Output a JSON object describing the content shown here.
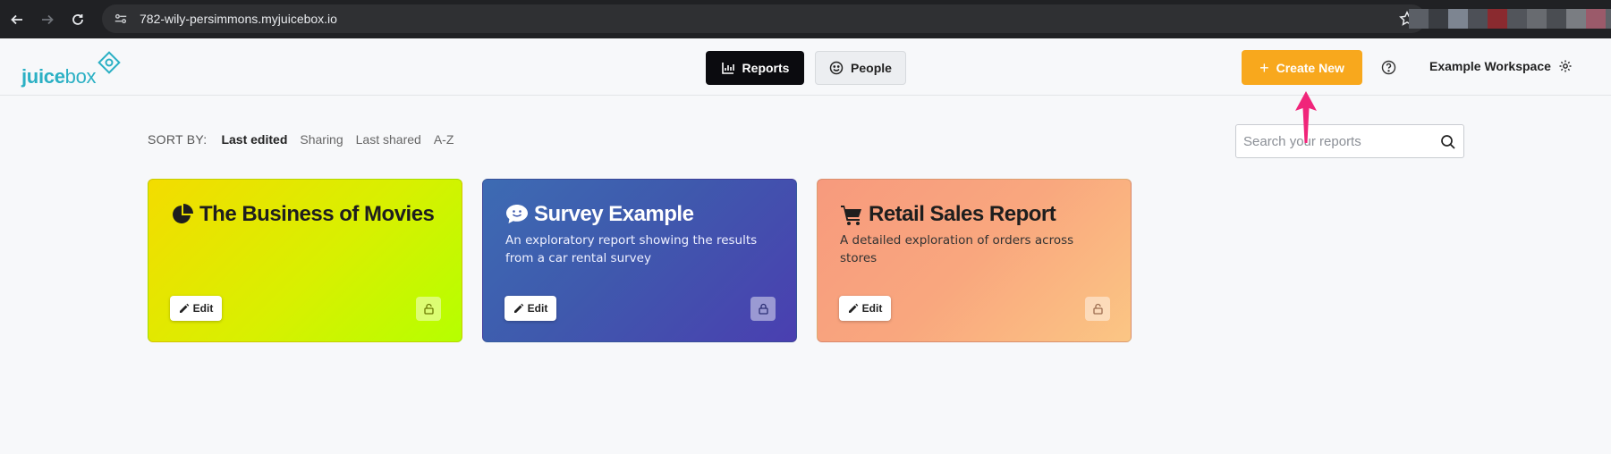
{
  "browser": {
    "url": "782-wily-persimmons.myjuicebox.io",
    "ext_colors": [
      "#5b5f66",
      "#3a3d42",
      "#7d8591",
      "#4d5057",
      "#8a2a2f",
      "#52555b",
      "#686b70",
      "#4a4d52",
      "#7a7d82",
      "#9b5a6a",
      "#5f6268"
    ]
  },
  "header": {
    "logo_text_bold": "juice",
    "logo_text_light": "box",
    "tabs": [
      {
        "label": "Reports",
        "icon": "bar-chart-icon",
        "active": true
      },
      {
        "label": "People",
        "icon": "smiley-icon",
        "active": false
      }
    ],
    "create_label": "Create New",
    "workspace_label": "Example Workspace"
  },
  "sort": {
    "label": "SORT BY:",
    "options": [
      {
        "label": "Last edited",
        "active": true
      },
      {
        "label": "Sharing",
        "active": false
      },
      {
        "label": "Last shared",
        "active": false
      },
      {
        "label": "A-Z",
        "active": false
      }
    ]
  },
  "search": {
    "placeholder": "Search your reports"
  },
  "cards": [
    {
      "title": "The Business of Movies",
      "description": "",
      "icon": "pie-chart-icon",
      "edit_label": "Edit"
    },
    {
      "title": "Survey Example",
      "description": "An exploratory report showing the results from a car rental survey",
      "icon": "comment-smile-icon",
      "edit_label": "Edit"
    },
    {
      "title": "Retail Sales Report",
      "description": "A detailed exploration of orders across stores",
      "icon": "shopping-cart-icon",
      "edit_label": "Edit"
    }
  ],
  "colors": {
    "accent": "#f8a81d",
    "brand": "#2bb0c4",
    "annotation_arrow": "#f0257a"
  }
}
